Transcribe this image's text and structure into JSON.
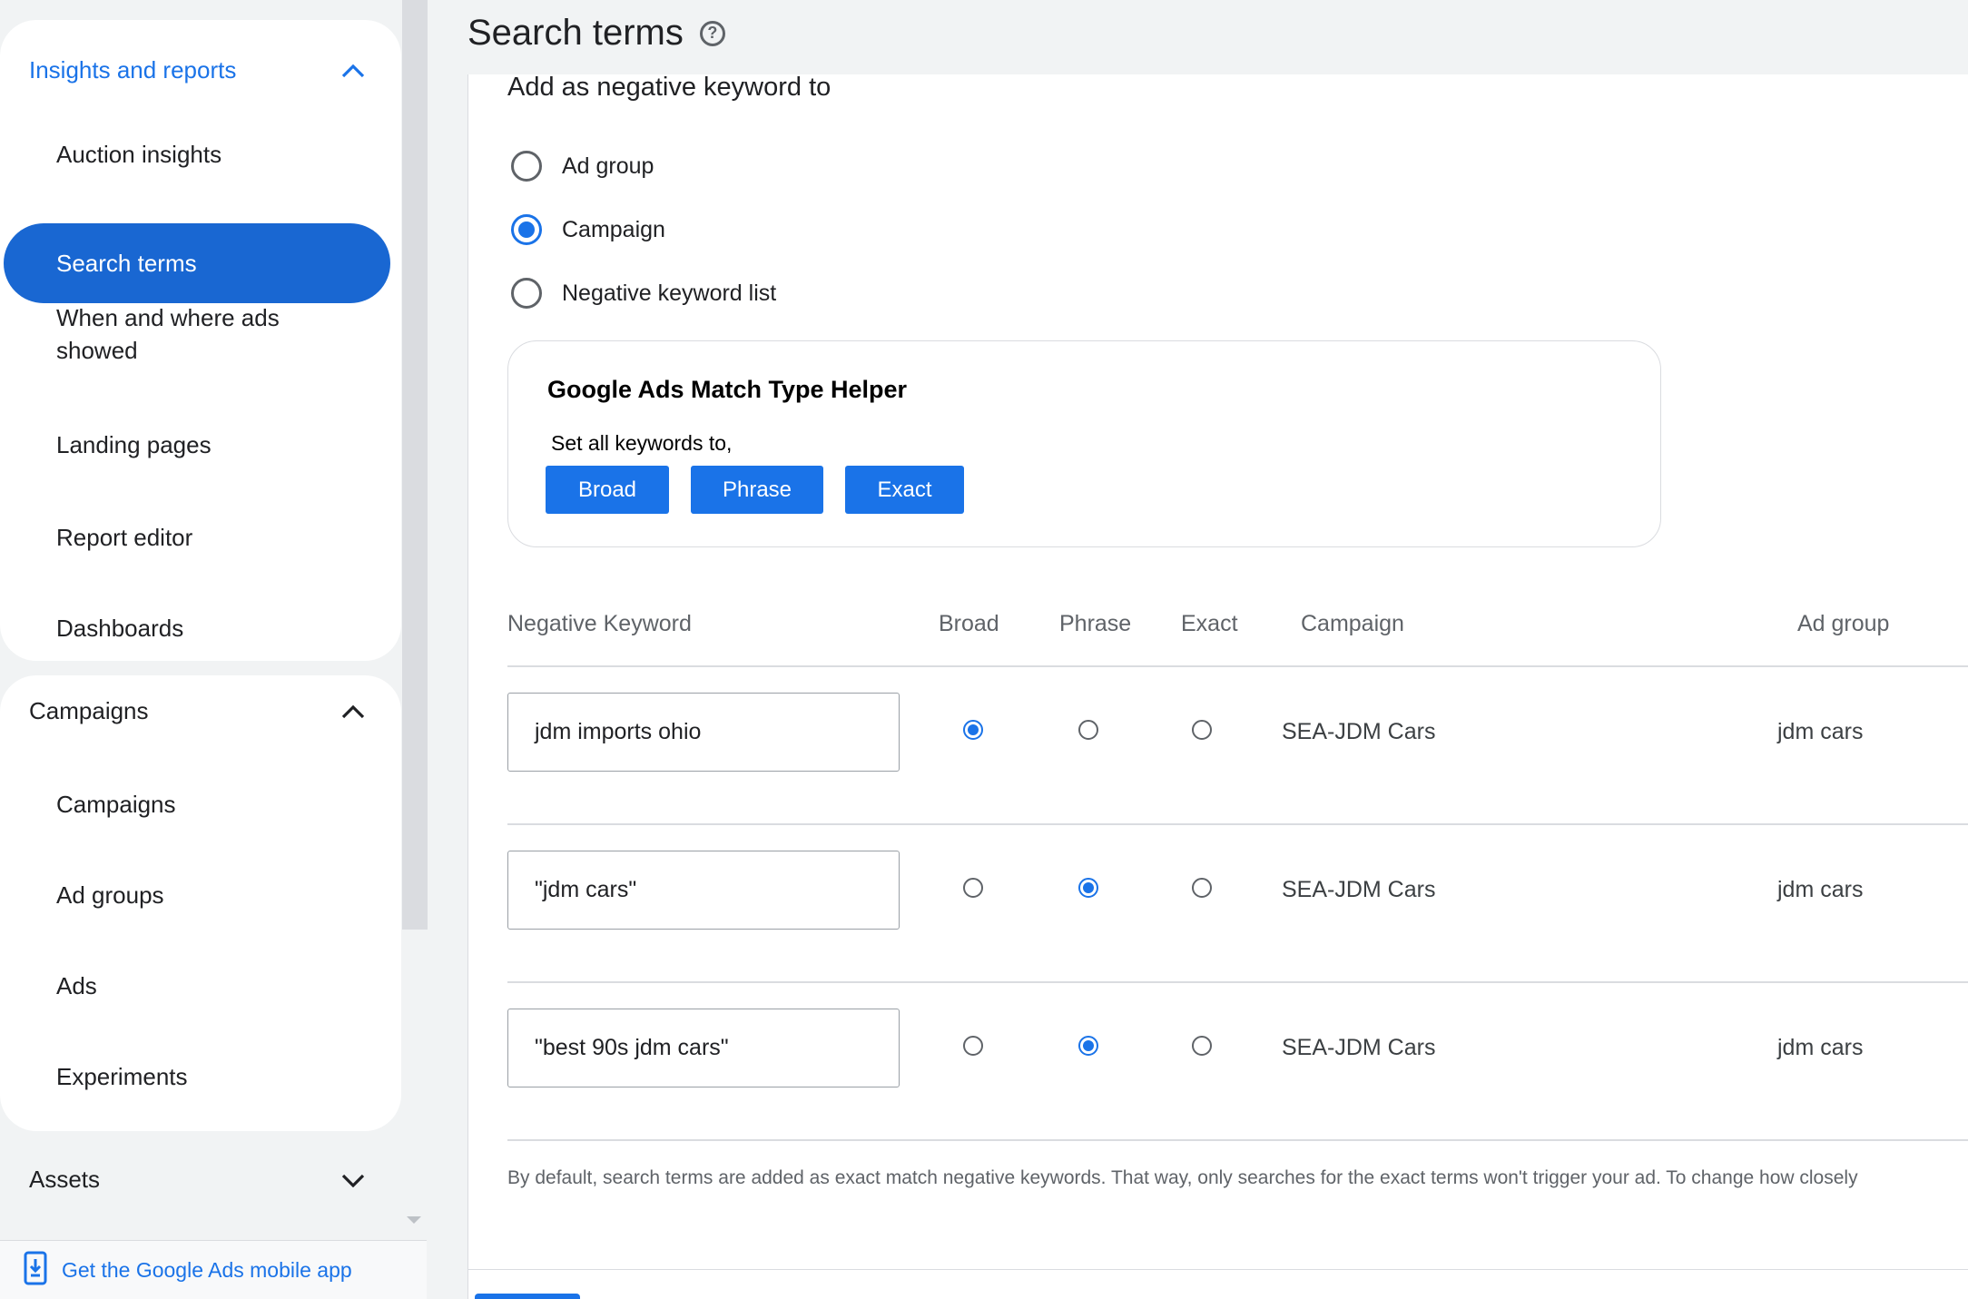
{
  "sidebar": {
    "insights": {
      "title": "Insights and reports",
      "items": [
        "Auction insights",
        "Search terms",
        "When and where ads",
        "showed",
        "Landing pages",
        "Report editor",
        "Dashboards"
      ]
    },
    "campaigns": {
      "title": "Campaigns",
      "items": [
        "Campaigns",
        "Ad groups",
        "Ads",
        "Experiments"
      ]
    },
    "assets": {
      "title": "Assets"
    },
    "mobile_app_link": "Get the Google Ads mobile app"
  },
  "header": {
    "title": "Search terms"
  },
  "main": {
    "subtitle": "Add as negative keyword to",
    "radio_options": [
      {
        "label": "Ad group",
        "selected": false
      },
      {
        "label": "Campaign",
        "selected": true
      },
      {
        "label": "Negative keyword list",
        "selected": false
      }
    ],
    "helper": {
      "title": "Google Ads Match Type Helper",
      "subtitle": "Set all keywords to,",
      "buttons": [
        "Broad",
        "Phrase",
        "Exact"
      ]
    },
    "table": {
      "headers": [
        "Negative Keyword",
        "Broad",
        "Phrase",
        "Exact",
        "Campaign",
        "Ad group"
      ],
      "rows": [
        {
          "keyword": "jdm imports ohio",
          "match": "Broad",
          "campaign": "SEA-JDM Cars",
          "ad_group": "jdm cars"
        },
        {
          "keyword": "\"jdm cars\"",
          "match": "Phrase",
          "campaign": "SEA-JDM Cars",
          "ad_group": "jdm cars"
        },
        {
          "keyword": "\"best 90s jdm cars\"",
          "match": "Phrase",
          "campaign": "SEA-JDM Cars",
          "ad_group": "jdm cars"
        }
      ]
    },
    "note": "By default, search terms are added as exact match negative keywords. That way, only searches for the exact terms won't trigger your ad. To change how closely"
  },
  "colors": {
    "accent": "#1a73e8",
    "active_nav": "#1967d2",
    "background": "#f1f3f4"
  }
}
